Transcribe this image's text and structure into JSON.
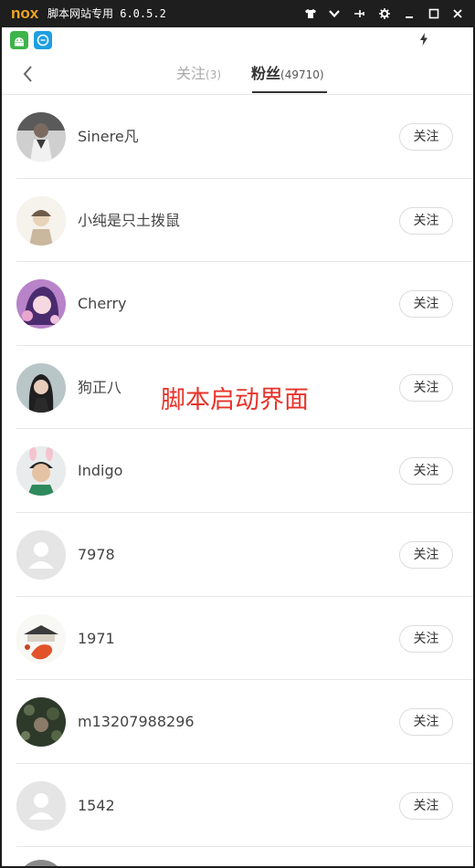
{
  "window": {
    "logo": "nox",
    "title": "脚本网站专用 6.0.5.2",
    "controls": [
      "shirt-icon",
      "chevron-down-icon",
      "pin-icon",
      "gear-icon",
      "minimize-icon",
      "maximize-icon",
      "close-icon"
    ]
  },
  "statusbar": {
    "icons": [
      "android-app-icon",
      "app-store-icon",
      "charging-icon"
    ]
  },
  "navbar": {
    "back_icon": "chevron-left-icon",
    "tabs": [
      {
        "label": "关注",
        "count": "(3)",
        "active": false
      },
      {
        "label": "粉丝",
        "count": "(49710)",
        "active": true
      }
    ]
  },
  "overlay": {
    "text": "脚本启动界面",
    "color": "#e8332a"
  },
  "colors": {
    "accent_text": "#333333",
    "muted_text": "#aaaaaa",
    "divider": "#e6e6e6",
    "logo": "#f5a623"
  },
  "fans": [
    {
      "name": "Sinere凡",
      "button": "关注",
      "avatar": "photo"
    },
    {
      "name": "小纯是只土拨鼠",
      "button": "关注",
      "avatar": "photo"
    },
    {
      "name": "Cherry",
      "button": "关注",
      "avatar": "photo"
    },
    {
      "name": "狗正八",
      "button": "关注",
      "avatar": "photo"
    },
    {
      "name": "Indigo",
      "button": "关注",
      "avatar": "photo"
    },
    {
      "name": "7978",
      "button": "关注",
      "avatar": "default"
    },
    {
      "name": "1971",
      "button": "关注",
      "avatar": "photo"
    },
    {
      "name": "m13207988296",
      "button": "关注",
      "avatar": "photo"
    },
    {
      "name": "1542",
      "button": "关注",
      "avatar": "default"
    }
  ]
}
